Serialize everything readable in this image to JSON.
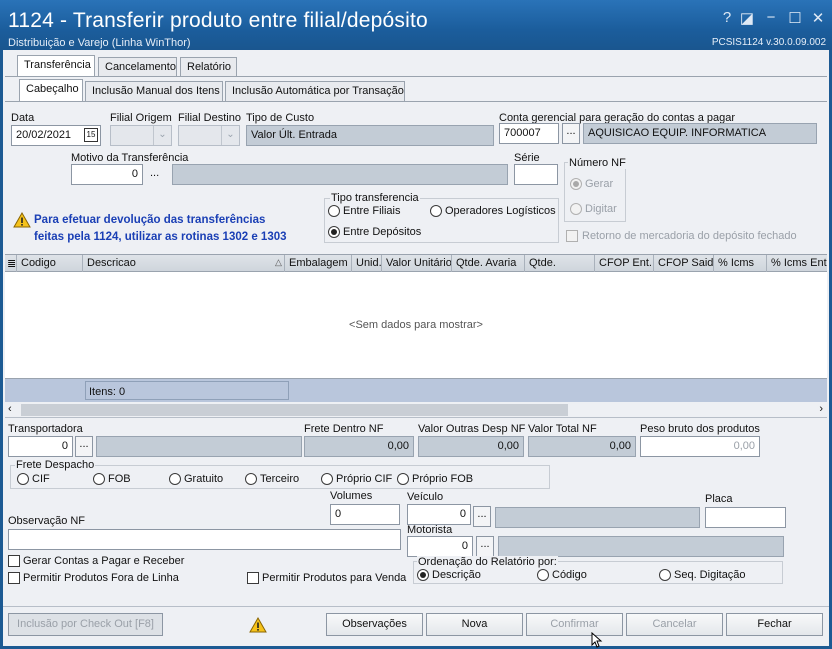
{
  "window": {
    "title": "1124 - Transferir produto entre filial/depósito",
    "subtitle": "Distribuição e Varejo (Linha WinThor)",
    "version": "PCSIS1124  v.30.0.09.002",
    "help_glyph": "?",
    "restore_glyph": "◪",
    "minimize_glyph": "−",
    "maximize_glyph": "☐",
    "close_glyph": "✕"
  },
  "main_tabs": [
    "Transferência",
    "Cancelamento",
    "Relatório"
  ],
  "sub_tabs": [
    "Cabeçalho",
    "Inclusão Manual dos Itens",
    "Inclusão Automática por Transação"
  ],
  "header": {
    "data_label": "Data",
    "data_value": "20/02/2021",
    "calendar_glyph": "15",
    "filial_origem_label": "Filial Origem",
    "filial_destino_label": "Filial Destino",
    "tipo_custo_label": "Tipo de Custo",
    "tipo_custo_value": "Valor Últ. Entrada",
    "conta_label": "Conta gerencial para geração do contas a pagar",
    "conta_code": "700007",
    "conta_desc": "AQUISICAO EQUIP. INFORMATICA",
    "motivo_label": "Motivo da Transferência",
    "motivo_value": "0",
    "serie_label": "Série",
    "serie_value": "",
    "ellipsis": "...",
    "combo_arrow": "⌄"
  },
  "numero_nf": {
    "label": "Número NF",
    "gerar": "Gerar",
    "digitar": "Digitar"
  },
  "tipo_transferencia": {
    "label": "Tipo transferencia",
    "entre_filiais": "Entre Filiais",
    "operadores": "Operadores Logísticos",
    "entre_depositos": "Entre Depósitos"
  },
  "retorno_label": "Retorno de mercadoria do depósito fechado",
  "warning_text": [
    "Para efetuar devolução das transferências",
    "feitas pela 1124, utilizar as rotinas 1302 e 1303"
  ],
  "grid": {
    "columns": [
      "Codigo",
      "Descricao",
      "Embalagem",
      "Unid.",
      "Valor Unitário",
      "Qtde. Avaria",
      "Qtde.",
      "CFOP Ent.",
      "CFOP Said.",
      "% Icms",
      "% Icms Ent"
    ],
    "empty_text": "<Sem dados para mostrar>",
    "items_count": "Itens: 0"
  },
  "footer": {
    "transportadora_label": "Transportadora",
    "transportadora_value": "0",
    "frete_dentro_label": "Frete Dentro NF",
    "frete_dentro_value": "0,00",
    "outras_desp_label": "Valor Outras Desp NF",
    "outras_desp_value": "0,00",
    "total_label": "Valor Total NF",
    "total_value": "0,00",
    "peso_label": "Peso bruto dos produtos",
    "peso_value": "0,00",
    "frete_despacho_label": "Frete Despacho",
    "frete_options": [
      "CIF",
      "FOB",
      "Gratuito",
      "Terceiro",
      "Próprio CIF",
      "Próprio FOB"
    ],
    "volumes_label": "Volumes",
    "volumes_value": "0",
    "veiculo_label": "Veículo",
    "veiculo_value": "0",
    "placa_label": "Placa",
    "placa_value": "",
    "observacao_label": "Observação NF",
    "motorista_label": "Motorista",
    "motorista_value": "0",
    "gerar_contas": "Gerar Contas a Pagar e Receber",
    "permitir_fora_linha": "Permitir Produtos Fora de Linha",
    "permitir_venda": "Permitir Produtos para Venda",
    "ordenacao_label": "Ordenação do Relatório por:",
    "ordenacao_options": [
      "Descrição",
      "Código",
      "Seq. Digitação"
    ]
  },
  "buttons": {
    "checkout": "Inclusão por Check Out  [F8]",
    "observacoes": "Observações",
    "nova": "Nova",
    "confirmar": "Confirmar",
    "cancelar": "Cancelar",
    "fechar": "Fechar"
  },
  "colors": {
    "titlebar": "#1b5d9c",
    "warning_text": "#1a3fb5",
    "readonly_field": "#c3ccd6",
    "grid_footer": "#b9c6dc"
  }
}
